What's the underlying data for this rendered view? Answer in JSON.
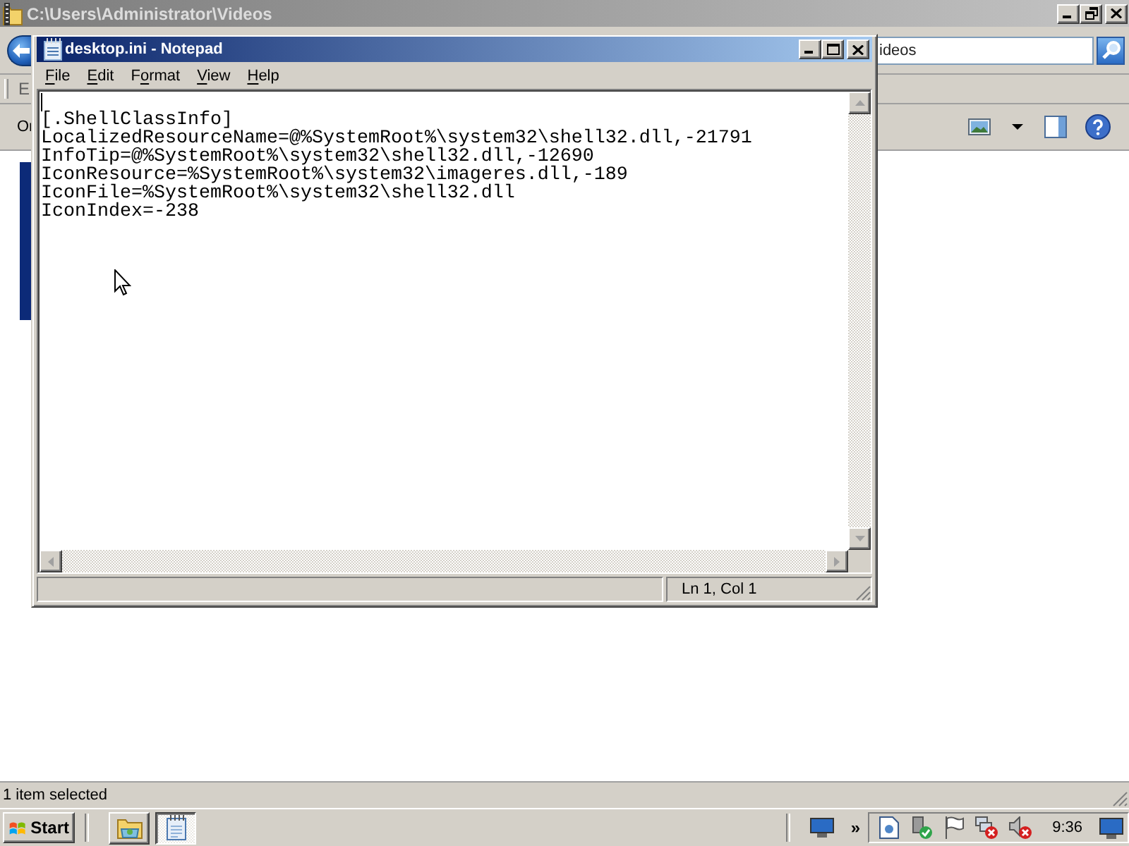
{
  "explorer": {
    "title": "C:\\Users\\Administrator\\Videos",
    "search": {
      "placeholder": "ideos"
    },
    "menu_bar": {
      "visible_text": "E"
    },
    "toolbar": {
      "visible_text": "Or"
    },
    "status_bar": {
      "text": "1 item selected"
    }
  },
  "notepad": {
    "title": "desktop.ini - Notepad",
    "menu": [
      {
        "segments": [
          {
            "text": "F",
            "underlined": true
          },
          {
            "text": "ile",
            "underlined": false
          }
        ]
      },
      {
        "segments": [
          {
            "text": "E",
            "underlined": true
          },
          {
            "text": "dit",
            "underlined": false
          }
        ]
      },
      {
        "segments": [
          {
            "text": "F",
            "underlined": false
          },
          {
            "text": "o",
            "underlined": true
          },
          {
            "text": "rmat",
            "underlined": false
          }
        ]
      },
      {
        "segments": [
          {
            "text": "V",
            "underlined": true
          },
          {
            "text": "iew",
            "underlined": false
          }
        ]
      },
      {
        "segments": [
          {
            "text": "H",
            "underlined": true
          },
          {
            "text": "elp",
            "underlined": false
          }
        ]
      }
    ],
    "lines": [
      "[.ShellClassInfo]",
      "LocalizedResourceName=@%SystemRoot%\\system32\\shell32.dll,-21791",
      "InfoTip=@%SystemRoot%\\system32\\shell32.dll,-12690",
      "IconResource=%SystemRoot%\\system32\\imageres.dll,-189",
      "IconFile=%SystemRoot%\\system32\\shell32.dll",
      "IconIndex=-238"
    ],
    "status": "Ln 1, Col 1"
  },
  "taskbar": {
    "start": "Start",
    "buttons": [
      {
        "kind": "explorer",
        "selected": false
      },
      {
        "kind": "notepad",
        "selected": true
      }
    ],
    "overflow": "»",
    "clock": "9:36"
  }
}
